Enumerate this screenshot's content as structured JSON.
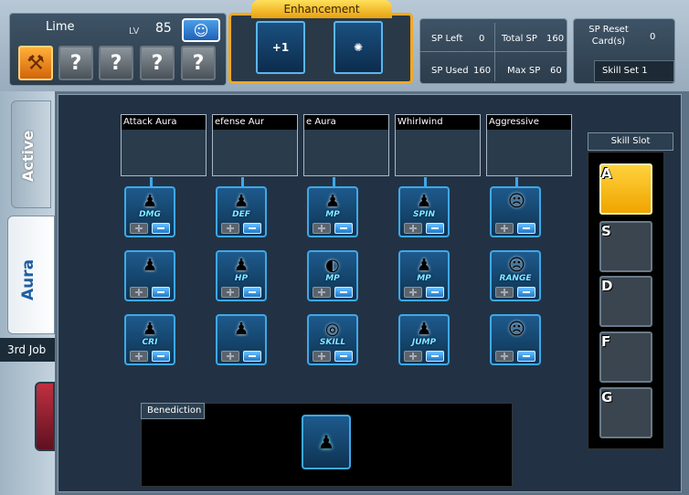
{
  "character": {
    "name": "Lime",
    "lv_label": "LV",
    "level": "85",
    "job_slots": [
      {
        "icon": "axe-icon",
        "label": ""
      },
      {
        "icon": "question-icon",
        "label": "?"
      },
      {
        "icon": "question-icon",
        "label": "?"
      },
      {
        "icon": "question-icon",
        "label": "?"
      },
      {
        "icon": "question-icon",
        "label": "?"
      }
    ]
  },
  "enhancement": {
    "title": "Enhancement",
    "slots": [
      {
        "icon": "sp-plus-one-icon",
        "label": "+1"
      },
      {
        "icon": "orb-figure-icon",
        "label": ""
      }
    ]
  },
  "stats": {
    "sp_left_label": "SP Left",
    "sp_left": "0",
    "total_sp_label": "Total SP",
    "total_sp": "160",
    "sp_used_label": "SP Used",
    "sp_used": "160",
    "max_sp_label": "Max SP",
    "max_sp": "60"
  },
  "reset": {
    "label": "SP Reset Card(s)",
    "value": "0",
    "skill_set": "Skill Set 1"
  },
  "side_tabs": {
    "active": "Active",
    "aura": "Aura",
    "job": "3rd Job"
  },
  "tree": {
    "columns": [
      {
        "title": "Attack Aura",
        "skills": [
          {
            "label": "DMG"
          },
          {
            "label": ""
          },
          {
            "label": "CRI"
          }
        ]
      },
      {
        "title": "efense Aur",
        "skills": [
          {
            "label": "DEF"
          },
          {
            "label": "HP"
          },
          {
            "label": ""
          }
        ]
      },
      {
        "title": "e Aura",
        "skills": [
          {
            "label": "MP"
          },
          {
            "label": "MP"
          },
          {
            "label": "SKILL"
          }
        ]
      },
      {
        "title": "Whirlwind",
        "skills": [
          {
            "label": "SPIN"
          },
          {
            "label": "MP"
          },
          {
            "label": "JUMP"
          }
        ]
      },
      {
        "title": "Aggressive",
        "skills": [
          {
            "label": ""
          },
          {
            "label": "RANGE"
          },
          {
            "label": ""
          }
        ]
      }
    ]
  },
  "benediction": {
    "title": "Benediction"
  },
  "skill_slot": {
    "title": "Skill Slot",
    "keys": [
      "A",
      "S",
      "D",
      "F",
      "G"
    ]
  }
}
